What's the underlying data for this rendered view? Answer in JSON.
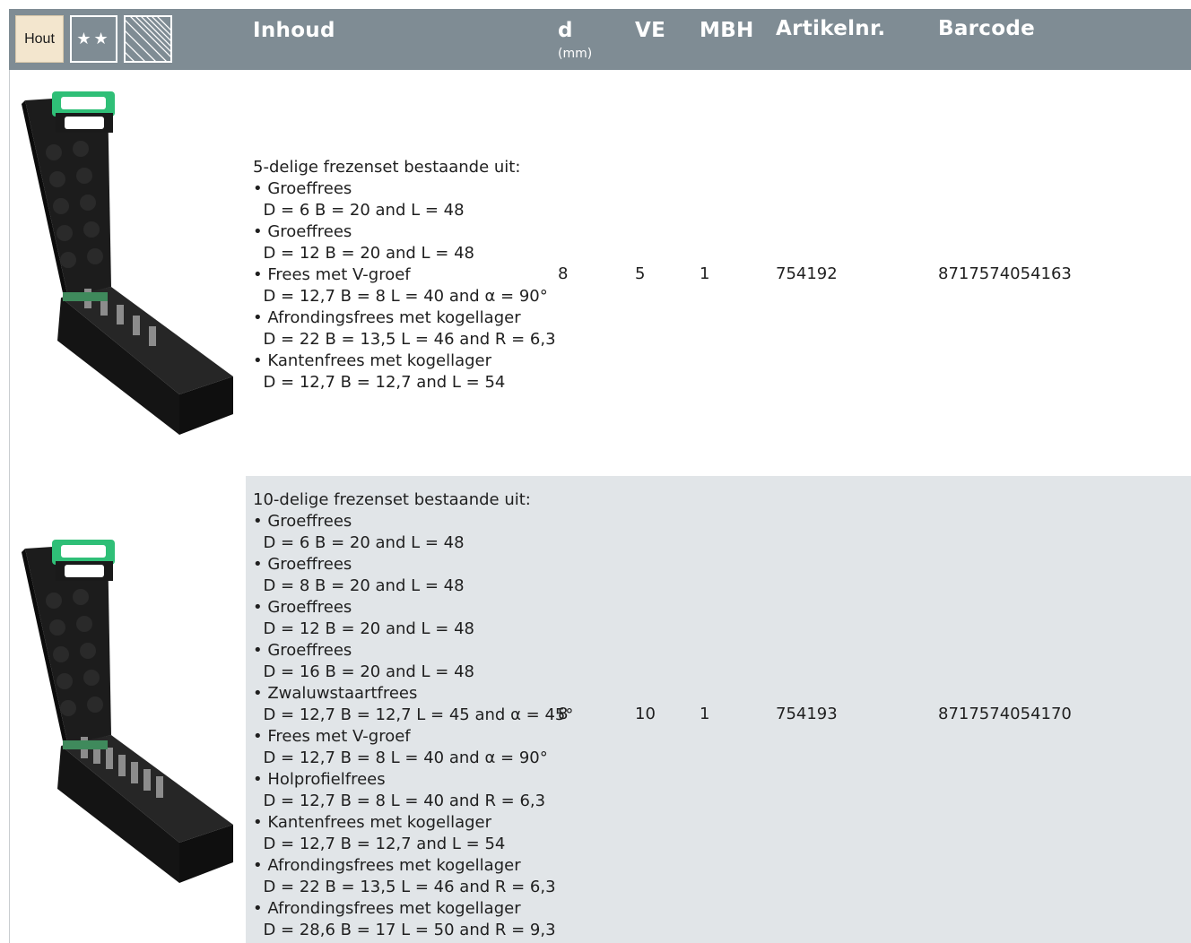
{
  "header": {
    "material_badge": "Hout",
    "stars": "★★",
    "col_inhoud": "Inhoud",
    "col_d": "d",
    "col_d_unit": "(mm)",
    "col_ve": "VE",
    "col_mbh": "MBH",
    "col_artikelnr": "Artikelnr.",
    "col_barcode": "Barcode"
  },
  "colors": {
    "header_bg": "#7f8c94",
    "row_alt_bg": "#e1e5e8",
    "badge_hout_bg": "#f3e6ce",
    "case_handle": "#2fbf77"
  },
  "rows": [
    {
      "description": "5-delige frezenset bestaande uit:\n• Groeffrees\n  D = 6 B = 20 and L = 48\n• Groeffrees\n  D = 12 B = 20 and L = 48\n• Frees met V-groef\n  D = 12,7 B = 8 L = 40 and α = 90°\n• Afrondingsfrees met kogellager\n  D = 22 B = 13,5 L = 46 and R = 6,3\n• Kantenfrees met kogellager\n  D = 12,7 B = 12,7 and L = 54",
      "d": "8",
      "ve": "5",
      "mbh": "1",
      "artikelnr": "754192",
      "barcode": "8717574054163"
    },
    {
      "description": "10-delige frezenset bestaande uit:\n• Groeffrees\n  D = 6 B = 20 and L = 48\n• Groeffrees\n  D = 8 B = 20 and L = 48\n• Groeffrees\n  D = 12 B = 20 and L = 48\n• Groeffrees\n  D = 16 B = 20 and L = 48\n• Zwaluwstaartfrees\n  D = 12,7 B = 12,7 L = 45 and α = 45°\n• Frees met V-groef\n  D = 12,7 B = 8 L = 40 and α = 90°\n• Holprofielfrees\n  D = 12,7 B = 8 L = 40 and R = 6,3\n• Kantenfrees met kogellager\n  D = 12,7 B = 12,7 and L = 54\n• Afrondingsfrees met kogellager\n  D = 22 B = 13,5 L = 46 and R = 6,3\n• Afrondingsfrees met kogellager\n  D = 28,6 B = 17 L = 50 and R = 9,3",
      "d": "8",
      "ve": "10",
      "mbh": "1",
      "artikelnr": "754193",
      "barcode": "8717574054170"
    }
  ]
}
